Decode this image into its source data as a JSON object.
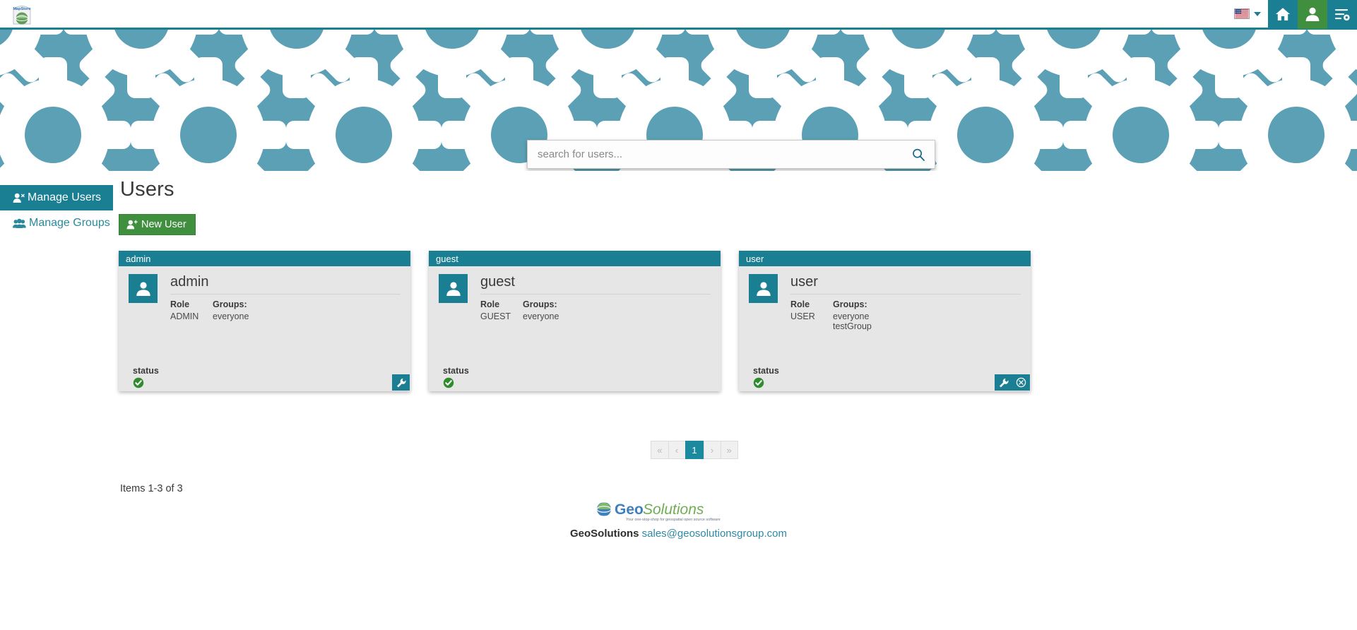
{
  "topbar": {
    "brand_name": "MapStore",
    "brand_icon": "mapstore-logo-icon",
    "language": {
      "flag_icon": "us-flag-icon",
      "selected": "English",
      "caret_icon": "chevron-down-icon"
    },
    "buttons": [
      {
        "name": "home-button",
        "icon": "home-icon",
        "title": "Home"
      },
      {
        "name": "account-button",
        "icon": "user-icon",
        "title": "Account"
      },
      {
        "name": "settings-button",
        "icon": "settings-icon",
        "title": "Settings"
      }
    ]
  },
  "hero": {
    "background_color": "#5ba0b5",
    "gear_color": "#ffffff"
  },
  "search": {
    "placeholder": "search for users...",
    "value": "",
    "icon": "search-icon"
  },
  "sidebar": {
    "items": [
      {
        "label": "Manage Users",
        "icon": "user-single-icon",
        "active": true
      },
      {
        "label": "Manage Groups",
        "icon": "users-group-icon",
        "active": false
      }
    ]
  },
  "main": {
    "title": "Users",
    "new_user_label": "New User",
    "new_user_icon": "user-plus-icon",
    "new_user_color": "#3f8f3f",
    "accent_color": "#1b7f93",
    "labels": {
      "role": "Role",
      "groups": "Groups:",
      "status": "status"
    },
    "cards": [
      {
        "header": "admin",
        "name": "admin",
        "role": "ADMIN",
        "groups": "everyone",
        "status": "enabled",
        "status_icon": "check-circle-icon",
        "actions": [
          {
            "name": "edit-user-button",
            "icon": "wrench-icon"
          }
        ]
      },
      {
        "header": "guest",
        "name": "guest",
        "role": "GUEST",
        "groups": "everyone",
        "status": "enabled",
        "status_icon": "check-circle-icon",
        "actions": []
      },
      {
        "header": "user",
        "name": "user",
        "role": "USER",
        "groups": "everyone\ntestGroup",
        "status": "enabled",
        "status_icon": "check-circle-icon",
        "actions": [
          {
            "name": "edit-user-button",
            "icon": "wrench-icon"
          },
          {
            "name": "delete-user-button",
            "icon": "delete-circle-icon"
          }
        ]
      }
    ]
  },
  "pagination": {
    "buttons": [
      {
        "label": "«",
        "name": "page-first",
        "active": false
      },
      {
        "label": "‹",
        "name": "page-previous",
        "active": false
      },
      {
        "label": "1",
        "name": "page-1",
        "active": true
      },
      {
        "label": "›",
        "name": "page-next",
        "active": false
      },
      {
        "label": "»",
        "name": "page-last",
        "active": false
      }
    ],
    "items_count": "Items 1-3 of 3"
  },
  "footer": {
    "logo_geo": "Geo",
    "logo_solutions": "Solutions",
    "tagline": "Your one-stop-shop for geospatial open source software",
    "company": "GeoSolutions",
    "email": "sales@geosolutionsgroup.com"
  }
}
